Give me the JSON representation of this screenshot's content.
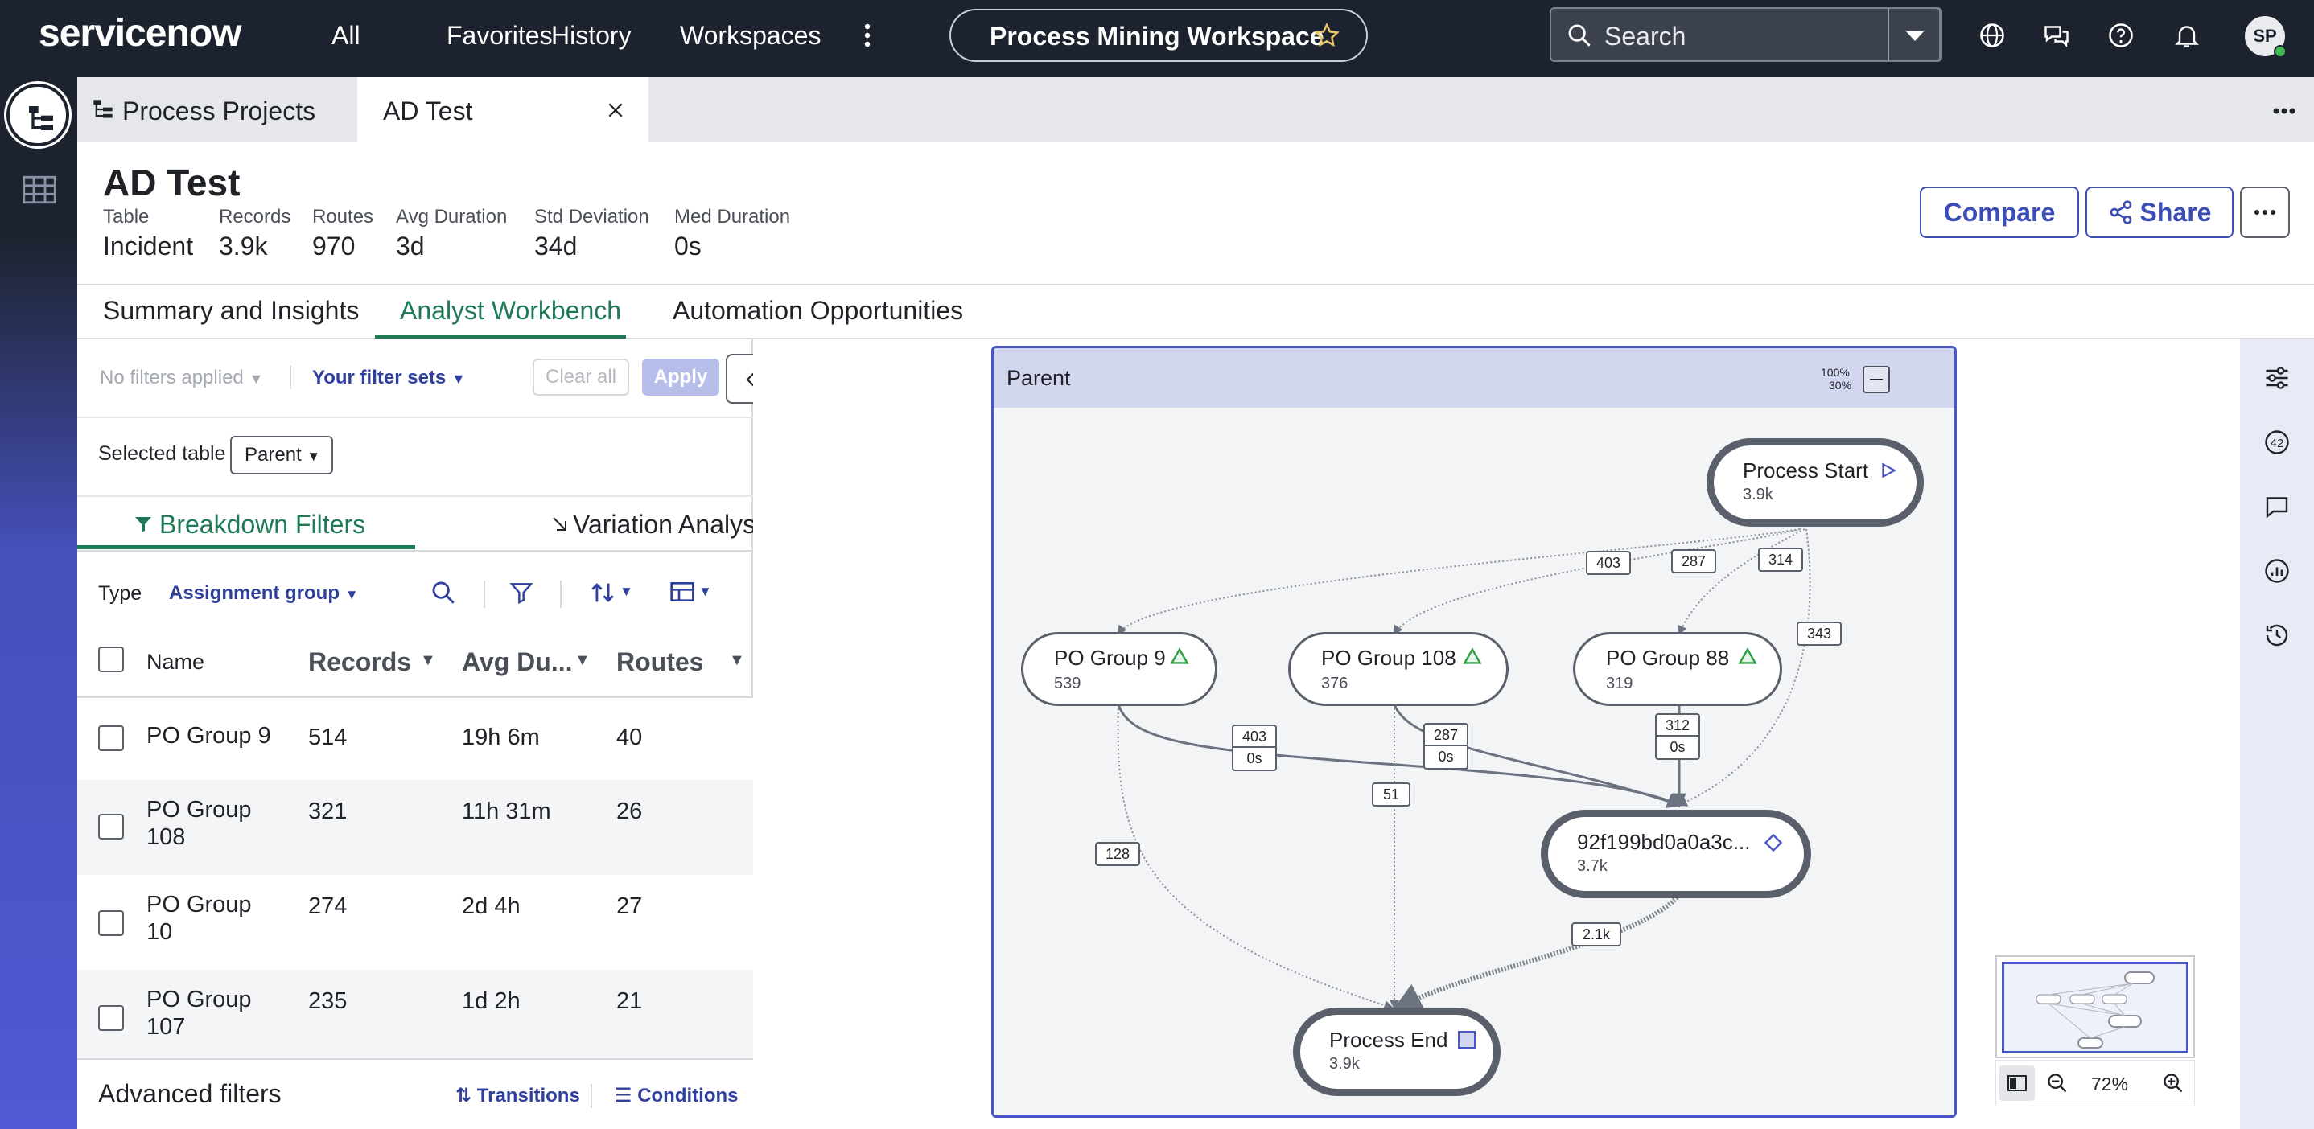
{
  "nav": {
    "brand": "servicenow",
    "links": [
      "All",
      "Favorites",
      "History",
      "Workspaces"
    ],
    "workspace_title": "Process Mining Workspace",
    "search_placeholder": "Search",
    "avatar_initials": "SP"
  },
  "tabs": {
    "process_projects": "Process Projects",
    "current": "AD Test"
  },
  "header": {
    "title": "AD Test",
    "stats": [
      {
        "label": "Table",
        "value": "Incident"
      },
      {
        "label": "Records",
        "value": "3.9k"
      },
      {
        "label": "Routes",
        "value": "970"
      },
      {
        "label": "Avg Duration",
        "value": "3d"
      },
      {
        "label": "Std Deviation",
        "value": "34d"
      },
      {
        "label": "Med Duration",
        "value": "0s"
      }
    ],
    "compare_label": "Compare",
    "share_label": "Share"
  },
  "subtabs": [
    "Summary and Insights",
    "Analyst Workbench",
    "Automation Opportunities"
  ],
  "filters": {
    "no_filters": "No filters applied",
    "filter_sets": "Your filter sets",
    "clear_all": "Clear all",
    "apply": "Apply",
    "selected_table_label": "Selected table",
    "selected_table_value": "Parent",
    "tab_breakdown": "Breakdown Filters",
    "tab_variation": "Variation Analysis",
    "type_label": "Type",
    "type_value": "Assignment group",
    "columns": [
      "Name",
      "Records",
      "Avg Du...",
      "Routes"
    ],
    "rows": [
      {
        "name": "PO Group 9",
        "records": "514",
        "avg": "19h 6m",
        "routes": "40"
      },
      {
        "name": "PO Group 108",
        "records": "321",
        "avg": "11h 31m",
        "routes": "26"
      },
      {
        "name": "PO Group 10",
        "records": "274",
        "avg": "2d 4h",
        "routes": "27"
      },
      {
        "name": "PO Group 107",
        "records": "235",
        "avg": "1d 2h",
        "routes": "21"
      }
    ],
    "advanced": "Advanced filters",
    "transitions": "Transitions",
    "conditions": "Conditions"
  },
  "map": {
    "panel_title": "Parent",
    "zoom_top": "100%",
    "zoom_bottom": "30%",
    "nodes": {
      "start": {
        "name": "Process Start",
        "count": "3.9k"
      },
      "g9": {
        "name": "PO Group 9",
        "count": "539"
      },
      "g108": {
        "name": "PO Group 108",
        "count": "376"
      },
      "g88": {
        "name": "PO Group 88",
        "count": "319"
      },
      "mid": {
        "name": "92f199bd0a0a3c...",
        "count": "3.7k"
      },
      "end": {
        "name": "Process End",
        "count": "3.9k"
      }
    },
    "edges": {
      "e403": "403",
      "e287": "287",
      "e314": "314",
      "e343": "343",
      "e403b": "403",
      "e403b_t": "0s",
      "e287b": "287",
      "e287b_t": "0s",
      "e312": "312",
      "e312_t": "0s",
      "e51": "51",
      "e128": "128",
      "e21k": "2.1k"
    },
    "zoom_level": "72%"
  }
}
